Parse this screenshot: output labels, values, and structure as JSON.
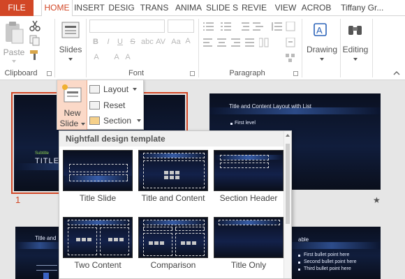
{
  "ribbon_tabs": {
    "file": "FILE",
    "home": "HOME",
    "insert": "INSERT",
    "design": "DESIG",
    "transitions": "TRANS",
    "animations": "ANIMA",
    "slideshow": "SLIDE S",
    "review": "REVIE",
    "view": "VIEW",
    "acrobat": "ACROB",
    "user": "Tiffany Gr..."
  },
  "ribbon": {
    "paste_label": "Paste",
    "slides_label": "Slides",
    "drawing_label": "Drawing",
    "editing_label": "Editing",
    "groups": {
      "clipboard": "Clipboard",
      "font": "Font",
      "paragraph": "Paragraph"
    }
  },
  "new_slide": {
    "label_line1": "New",
    "label_line2": "Slide",
    "options": {
      "layout": "Layout",
      "reset": "Reset",
      "section": "Section"
    }
  },
  "slides": {
    "slide1": {
      "number": "1",
      "subtitle": "Subtitle",
      "title": "TITLE L"
    },
    "slide2": {
      "title": "Title and Content Layout with List",
      "bullet": "First level"
    },
    "slide3": {
      "title": "Title and"
    },
    "slide4": {
      "title": "able",
      "bullets": [
        "First bullet point here",
        "Second bullet point here",
        "Third bullet point here"
      ]
    },
    "star_icon": "★"
  },
  "layout_gallery": {
    "header": "Nightfall design template",
    "layouts": [
      "Title Slide",
      "Title and Content",
      "Section Header",
      "Two Content",
      "Comparison",
      "Title Only"
    ]
  },
  "colors": {
    "accent": "#d24726",
    "selected_slide_border": "#d24726",
    "new_slide_highlight": "#fbd9c8"
  }
}
